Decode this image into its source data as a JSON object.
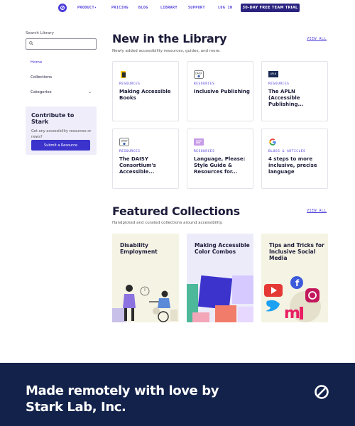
{
  "nav": {
    "items": [
      {
        "label": "PRODUCT",
        "chevron": "▾"
      },
      {
        "label": "PRICING"
      },
      {
        "label": "BLOG"
      },
      {
        "label": "LIBRARY"
      },
      {
        "label": "SUPPORT"
      },
      {
        "label": "LOG IN"
      }
    ],
    "cta": "30-DAY FREE TEAM TRIAL"
  },
  "sidebar": {
    "search_label": "Search Library",
    "search_placeholder": "",
    "links": {
      "home": "Home",
      "collections": "Collections",
      "categories": "Categories"
    },
    "contribute": {
      "title": "Contribute to Stark",
      "text": "Get any accessibility resources or news?",
      "button": "Submit a Resource"
    }
  },
  "library": {
    "title": "New in the Library",
    "subtitle": "Newly added accessibility resources, guides, and more.",
    "view_all": "VIEW ALL",
    "cards": [
      {
        "tag": "RESOURCES",
        "title": "Making Accessible Books",
        "icon": "making-books-icon"
      },
      {
        "tag": "RESOURCES",
        "title": "Inclusive Publishing",
        "icon": "daisy-logo-icon"
      },
      {
        "tag": "RESOURCES",
        "title": "The APLN (Accessible Publishing...",
        "icon": "apln-logo-icon"
      },
      {
        "tag": "RESOURCES",
        "title": "The DAISY Consortium's Accessible...",
        "icon": "daisy-logo-icon"
      },
      {
        "tag": "RESOURCES",
        "title": "Language, Please: Style Guide & Resources for...",
        "icon": "language-please-icon"
      },
      {
        "tag": "BLOGS & ARTICLES",
        "title": "4 steps to more inclusive, precise language",
        "icon": "google-logo-icon"
      }
    ]
  },
  "collections": {
    "title": "Featured Collections",
    "subtitle": "Handpicked and curated collections around accessibility.",
    "view_all": "VIEW ALL",
    "cards": [
      {
        "title": "Disability Employment",
        "bg": "#f5f3e3"
      },
      {
        "title": "Making Accessible Color Combos",
        "bg": "#ecebfa"
      },
      {
        "title": "Tips and Tricks for Inclusive Social Media",
        "bg": "#f5f3e3"
      }
    ]
  },
  "footer": {
    "line1": "Made remotely with love by",
    "line2": "Stark Lab, Inc."
  },
  "colors": {
    "accent": "#4a3ad9",
    "footer": "#13224a",
    "cta": "#2a2480"
  }
}
